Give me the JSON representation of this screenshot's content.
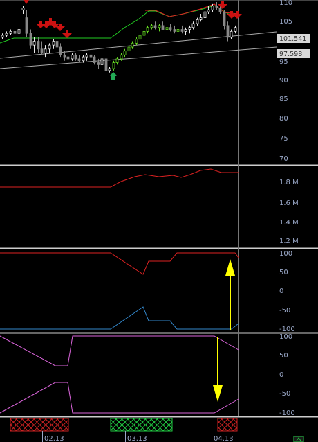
{
  "price_panel": {
    "ticks": [
      "110",
      "105",
      "100",
      "95",
      "90",
      "85",
      "80",
      "75",
      "70"
    ],
    "price_labels": [
      "101.541",
      "97.598"
    ]
  },
  "volume_panel": {
    "ticks": [
      "1.8 M",
      "1.6 M",
      "1.4 M",
      "1.2 M"
    ]
  },
  "oscillator1": {
    "ticks": [
      "100",
      "50",
      "0",
      "-50",
      "-100"
    ]
  },
  "oscillator2": {
    "ticks": [
      "100",
      "50",
      "0",
      "-50",
      "-100"
    ]
  },
  "x_axis": {
    "dates": [
      "02.13",
      "03.13",
      "04.13"
    ]
  },
  "colors": {
    "up_arrow": "#22aa55",
    "signal_arrow": "#ffff00",
    "red_line": "#dd2222",
    "blue_line": "#3388cc",
    "magenta_line": "#dd66dd",
    "green_band": "#22cc22",
    "bear_zone": "#cc2222",
    "bull_zone": "#22cc44"
  },
  "chart_data": [
    {
      "type": "line",
      "panel": "price",
      "series": [
        {
          "name": "",
          "x": [
            0,
            20,
            40,
            60,
            80,
            100,
            120,
            140,
            160,
            180,
            200,
            220,
            240,
            260,
            280,
            300,
            320,
            340
          ],
          "values": [
            101,
            101.5,
            100.5,
            101.5,
            98.5,
            99,
            96.5,
            98,
            100,
            104,
            106,
            107,
            107.5,
            108,
            108.8,
            110.5,
            109.5,
            109
          ]
        }
      ],
      "ylim": [
        70,
        110
      ]
    },
    {
      "type": "line",
      "panel": "volume",
      "series": [
        {
          "name": "",
          "x": [
            0,
            160,
            180,
            200,
            220,
            240,
            260,
            280,
            300,
            320,
            340
          ],
          "values": [
            1.74,
            1.74,
            1.79,
            1.85,
            1.86,
            1.84,
            1.86,
            1.85,
            1.9,
            1.91,
            1.89
          ]
        }
      ]
    },
    {
      "type": "line",
      "panel": "oscillator1",
      "series": [
        {
          "name": "",
          "x": [
            0,
            160,
            205,
            215,
            245,
            255,
            340
          ],
          "values": [
            100,
            100,
            42,
            80,
            80,
            100,
            100
          ]
        },
        {
          "name": "",
          "x": [
            0,
            160,
            205,
            215,
            245,
            255,
            340
          ],
          "values": [
            -100,
            -100,
            -42,
            -80,
            -80,
            -100,
            -100
          ]
        }
      ],
      "ylim": [
        -100,
        100
      ]
    },
    {
      "type": "line",
      "panel": "oscillator2",
      "series": [
        {
          "name": "",
          "x": [
            0,
            80,
            98,
            105,
            310,
            345
          ],
          "values": [
            100,
            28,
            28,
            100,
            100,
            82
          ]
        },
        {
          "name": "",
          "x": [
            0,
            80,
            98,
            105,
            310,
            345
          ],
          "values": [
            -100,
            -28,
            -28,
            -100,
            -100,
            -82
          ]
        }
      ],
      "ylim": [
        -100,
        100
      ]
    }
  ]
}
